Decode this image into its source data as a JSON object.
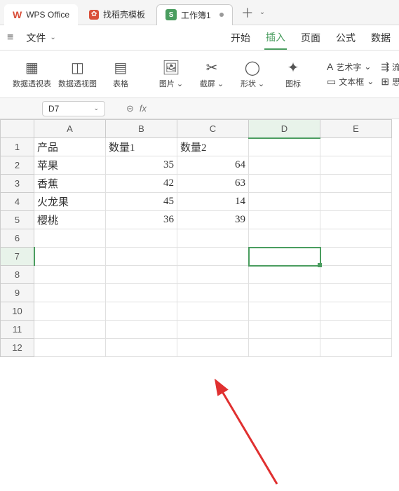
{
  "titlebar": {
    "wps_label": "WPS Office",
    "template_label": "找稻壳模板",
    "workbook_label": "工作簿1",
    "sheet_badge": "S"
  },
  "menubar": {
    "file": "文件",
    "items": [
      "开始",
      "插入",
      "页面",
      "公式",
      "数据"
    ],
    "active_index": 1
  },
  "ribbon": {
    "pivot_table": "数据透视表",
    "pivot_chart": "数据透视图",
    "table": "表格",
    "picture": "图片",
    "screenshot": "截屏",
    "shapes": "形状",
    "icons": "图标",
    "wordart": "艺术字",
    "textbox": "文本框",
    "flowchart": "流程图",
    "mindmap": "思维导图"
  },
  "fxbar": {
    "namebox": "D7",
    "fx": "fx"
  },
  "grid": {
    "cols": [
      "A",
      "B",
      "C",
      "D",
      "E"
    ],
    "rows_count": 12,
    "selected_col": "D",
    "selected_row": 7,
    "data": [
      {
        "A": "产品",
        "B": "数量1",
        "C": "数量2"
      },
      {
        "A": "苹果",
        "B": 35,
        "C": 64
      },
      {
        "A": "香蕉",
        "B": 42,
        "C": 63
      },
      {
        "A": "火龙果",
        "B": 45,
        "C": 14
      },
      {
        "A": "樱桃",
        "B": 36,
        "C": 39
      }
    ]
  },
  "chart_data": {
    "type": "table",
    "headers": [
      "产品",
      "数量1",
      "数量2"
    ],
    "rows": [
      [
        "苹果",
        35,
        64
      ],
      [
        "香蕉",
        42,
        63
      ],
      [
        "火龙果",
        45,
        14
      ],
      [
        "樱桃",
        36,
        39
      ]
    ]
  }
}
